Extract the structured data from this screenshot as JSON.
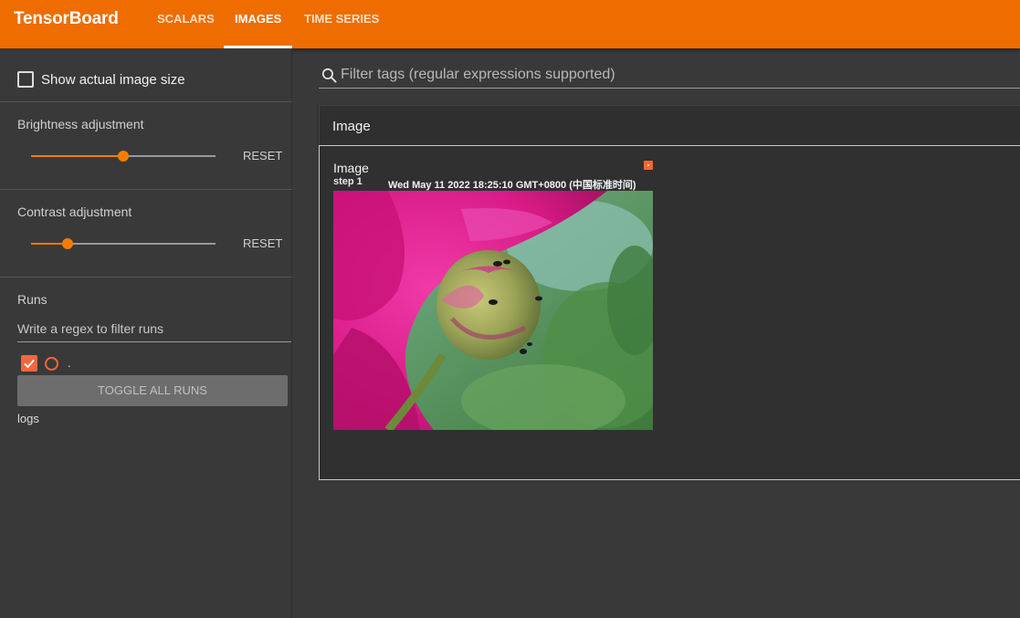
{
  "header": {
    "brand": "TensorBoard",
    "tabs": [
      {
        "label": "SCALARS",
        "active": false
      },
      {
        "label": "IMAGES",
        "active": true
      },
      {
        "label": "TIME SERIES",
        "active": false
      }
    ],
    "bar_color": "#ef6c00"
  },
  "sidebar": {
    "show_actual_size_label": "Show actual image size",
    "show_actual_size_checked": false,
    "brightness": {
      "title": "Brightness adjustment",
      "reset_label": "RESET",
      "value_fraction": 0.5
    },
    "contrast": {
      "title": "Contrast adjustment",
      "reset_label": "RESET",
      "value_fraction": 0.2
    },
    "runs": {
      "title": "Runs",
      "filter_placeholder": "Write a regex to filter runs",
      "items": [
        {
          "name": ".",
          "checked": true,
          "color": "#f2673b"
        }
      ],
      "toggle_all_label": "TOGGLE ALL RUNS",
      "log_dir": "logs"
    }
  },
  "main": {
    "tag_filter_placeholder": "Filter tags (regular expressions supported)",
    "group": {
      "title": "Image",
      "card": {
        "title": "Image",
        "step": "step 1",
        "timestamp": "Wed May 11 2022 18:25:10 GMT+0800 (中国标准时间)",
        "run_color": "#f2673b"
      }
    }
  },
  "icons": {
    "search": "search-icon",
    "check": "check-icon",
    "run_color": "run-color-circle-icon"
  }
}
